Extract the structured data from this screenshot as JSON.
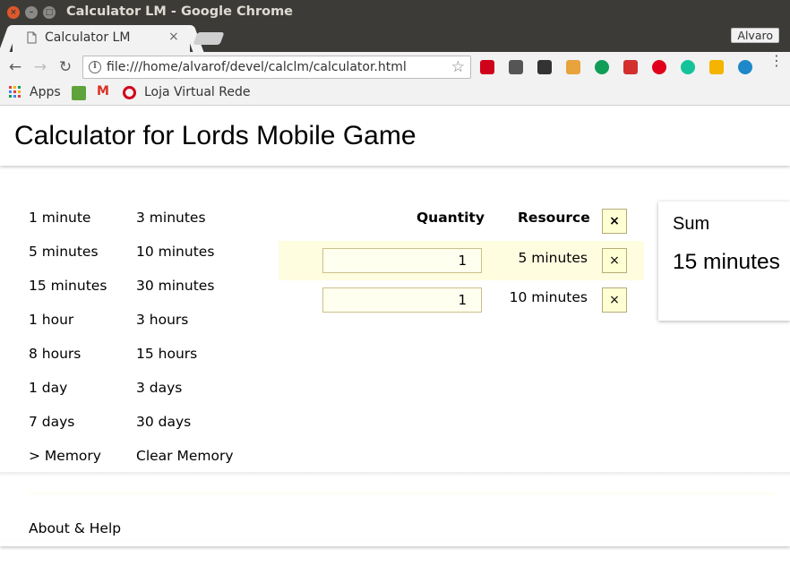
{
  "window": {
    "title": "Calculator LM - Google Chrome",
    "close_glyph": "×",
    "min_glyph": "–",
    "max_glyph": "□"
  },
  "tab": {
    "title": "Calculator LM",
    "close_glyph": "×"
  },
  "profile": {
    "name": "Alvaro"
  },
  "toolbar": {
    "back_glyph": "←",
    "forward_glyph": "→",
    "reload_glyph": "↻",
    "url": "file:///home/alvarof/devel/calclm/calculator.html",
    "info_glyph": "i",
    "star_glyph": "☆",
    "menu_glyph": "⋮",
    "extensions": [
      {
        "name": "lastpass-icon",
        "color": "#d0021b"
      },
      {
        "name": "pocket-icon",
        "color": "#555555"
      },
      {
        "name": "evernote-icon",
        "color": "#333333"
      },
      {
        "name": "cookie-icon",
        "color": "#e8a33d"
      },
      {
        "name": "hangouts-icon",
        "color": "#0f9d58"
      },
      {
        "name": "book-icon",
        "color": "#d32f2f"
      },
      {
        "name": "adobe-icon",
        "color": "#e0001b"
      },
      {
        "name": "grammarly-icon",
        "color": "#15c39a"
      },
      {
        "name": "keep-icon",
        "color": "#f4b400"
      },
      {
        "name": "tb-icon",
        "color": "#1e88c9"
      }
    ]
  },
  "bookmarks": {
    "apps_label": "Apps",
    "gmail_glyph": "M",
    "loja_label": "Loja Virtual Rede"
  },
  "app": {
    "title": "Calculator for Lords Mobile Game",
    "time_buttons": [
      [
        "1 minute",
        "3 minutes"
      ],
      [
        "5 minutes",
        "10 minutes"
      ],
      [
        "15 minutes",
        "30 minutes"
      ],
      [
        "1 hour",
        "3 hours"
      ],
      [
        "8 hours",
        "15 hours"
      ],
      [
        "1 day",
        "3 days"
      ],
      [
        "7 days",
        "30 days"
      ],
      [
        "> Memory",
        "Clear Memory"
      ]
    ],
    "table": {
      "quantity_header": "Quantity",
      "resource_header": "Resource",
      "clear_all_glyph": "×",
      "rows": [
        {
          "quantity": "1",
          "resource": "5 minutes",
          "delete_glyph": "×"
        },
        {
          "quantity": "1",
          "resource": "10 minutes",
          "delete_glyph": "×"
        }
      ]
    },
    "sum": {
      "label": "Sum",
      "value": "15 minutes"
    },
    "footer": {
      "about_label": "About & Help"
    }
  }
}
